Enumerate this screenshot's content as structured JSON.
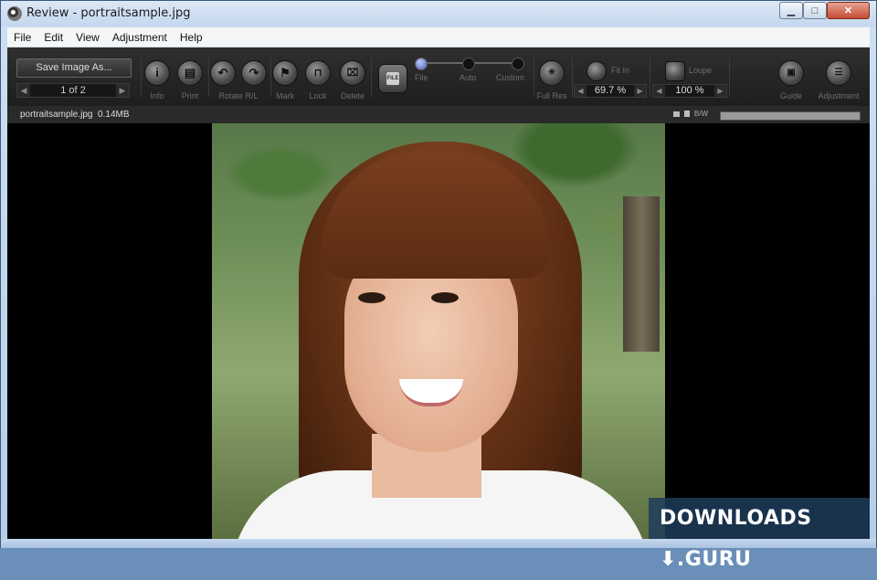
{
  "window": {
    "title": "Review - portraitsample.jpg",
    "controls": {
      "minimize": "▁",
      "maximize": "□",
      "close": "✕"
    }
  },
  "menu": [
    "File",
    "Edit",
    "View",
    "Adjustment",
    "Help"
  ],
  "toolbar": {
    "save_label": "Save Image As...",
    "pager": {
      "text": "1 of 2",
      "prev": "◀",
      "next": "▶"
    },
    "tools": [
      {
        "label": "Info",
        "icon": "info-icon",
        "glyph": "i"
      },
      {
        "label": "Print",
        "icon": "print-icon",
        "glyph": "▤"
      },
      {
        "label": "Rotate R/L",
        "icon": "rotate-icons",
        "glyph": "↶"
      },
      {
        "label": "Mark",
        "icon": "flag-icon",
        "glyph": "⚑"
      },
      {
        "label": "Lock",
        "icon": "lock-icon",
        "glyph": "🔒"
      },
      {
        "label": "Delete",
        "icon": "trash-icon",
        "glyph": "🗑"
      }
    ],
    "file_button_text": "FILE",
    "slider_labels": [
      "File",
      "Auto",
      "Custom"
    ],
    "full_res_label": "Full Res",
    "fit_in": {
      "label": "Fit In",
      "value": "69.7 %"
    },
    "loupe": {
      "label": "Loupe",
      "value": "100 %"
    },
    "guide_label": "Guide",
    "adjustment_label": "Adjustment"
  },
  "infobar": {
    "filename": "portraitsample.jpg",
    "filesize": "0.14MB",
    "bw_label": "B/W"
  },
  "watermark": "DOWNLOADS ⬇.GURU"
}
